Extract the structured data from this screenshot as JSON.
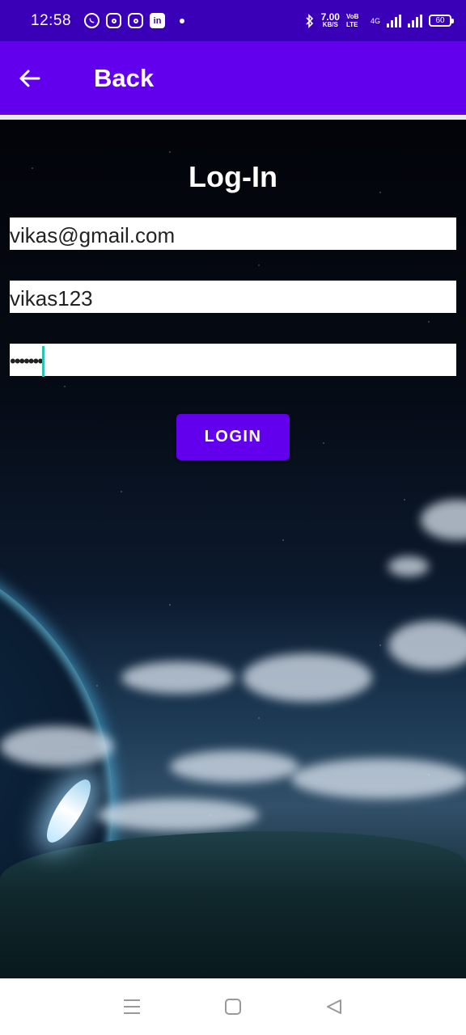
{
  "status_bar": {
    "time": "12:58",
    "app_icons": [
      "whatsapp-icon",
      "instagram-icon",
      "instagram-icon",
      "linkedin-icon"
    ],
    "linkedin_text": "in",
    "network_speed": "7.00",
    "network_speed_unit": "KB/S",
    "volte_label": "VoB LTE",
    "network_type": "4G",
    "battery": "60"
  },
  "app_bar": {
    "back_label": "Back",
    "background_color": "#6200ee"
  },
  "form": {
    "title": "Log-In",
    "email_value": "vikas@gmail.com",
    "username_value": "vikas123",
    "password_value": "•••••••",
    "login_label": "LOGIN",
    "button_color": "#6200ee"
  },
  "nav_bar": {
    "buttons": [
      "menu-icon",
      "home-icon",
      "back-triangle-icon"
    ]
  }
}
